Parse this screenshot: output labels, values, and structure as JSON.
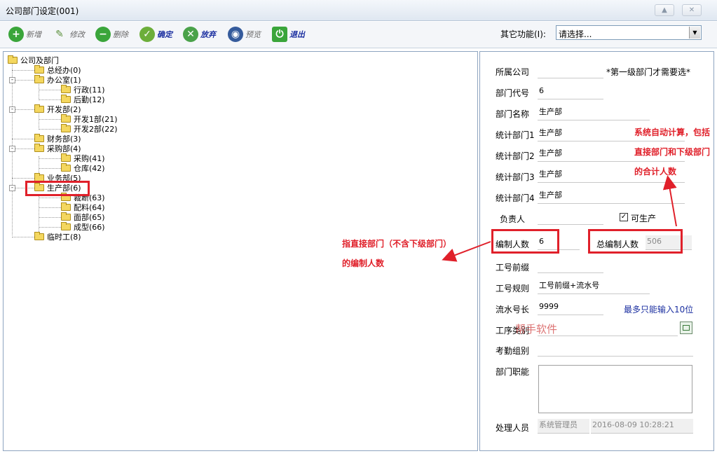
{
  "window": {
    "title": "公司部门设定(001)"
  },
  "toolbar": {
    "add": "新增",
    "edit": "修改",
    "delete": "删除",
    "ok": "确定",
    "discard": "放弃",
    "preview": "预览",
    "exit": "退出",
    "other_label": "其它功能(I):",
    "other_value": "请选择..."
  },
  "tree": {
    "root": "公司及部门",
    "n1": "总经办(0)",
    "n2": "办公室(1)",
    "n2a": "行政(11)",
    "n2b": "后勤(12)",
    "n3": "开发部(2)",
    "n3a": "开发1部(21)",
    "n3b": "开发2部(22)",
    "n4": "财务部(3)",
    "n5": "采购部(4)",
    "n5a": "采购(41)",
    "n5b": "仓库(42)",
    "n6": "业务部(5)",
    "n7": "生产部(6)",
    "n7a": "裁断(63)",
    "n7b": "配料(64)",
    "n7c": "面部(65)",
    "n7d": "成型(66)",
    "n8": "临时工(8)"
  },
  "form": {
    "company_label": "所属公司",
    "company_value": "",
    "company_hint": "*第一级部门才需要选*",
    "code_label": "部门代号",
    "code_value": "6",
    "name_label": "部门名称",
    "name_value": "生产部",
    "stat1_label": "统计部门1",
    "stat1_value": "生产部",
    "stat2_label": "统计部门2",
    "stat2_value": "生产部",
    "stat3_label": "统计部门3",
    "stat3_value": "生产部",
    "stat4_label": "统计部门4",
    "stat4_value": "生产部",
    "manager_label": "负责人",
    "manager_value": "",
    "producible_label": "可生产",
    "headcount_label": "编制人数",
    "headcount_value": "6",
    "total_label": "总编制人数",
    "total_value": "506",
    "prefix_label": "工号前缀",
    "prefix_value": "",
    "rule_label": "工号规则",
    "rule_value": "工号前缀+流水号",
    "serial_label": "流水号长",
    "serial_value": "9999",
    "serial_hint": "最多只能输入10位",
    "process_label": "工序类别",
    "process_value": "",
    "attendance_label": "考勤组别",
    "attendance_value": "",
    "duty_label": "部门职能",
    "duty_value": "",
    "handler_label": "处理人员",
    "handler_value": "系统管理员",
    "handler_time": "2016-08-09 10:28:21"
  },
  "annotations": {
    "note_right": "系统自动计算，包括直接部门和下级部门的合计人数",
    "note_left": "指直接部门（不含下级部门）的编制人数",
    "watermark": "帮手软件"
  },
  "colors": {
    "accent_red": "#e0202a",
    "active_blue": "#1b2fa0"
  }
}
